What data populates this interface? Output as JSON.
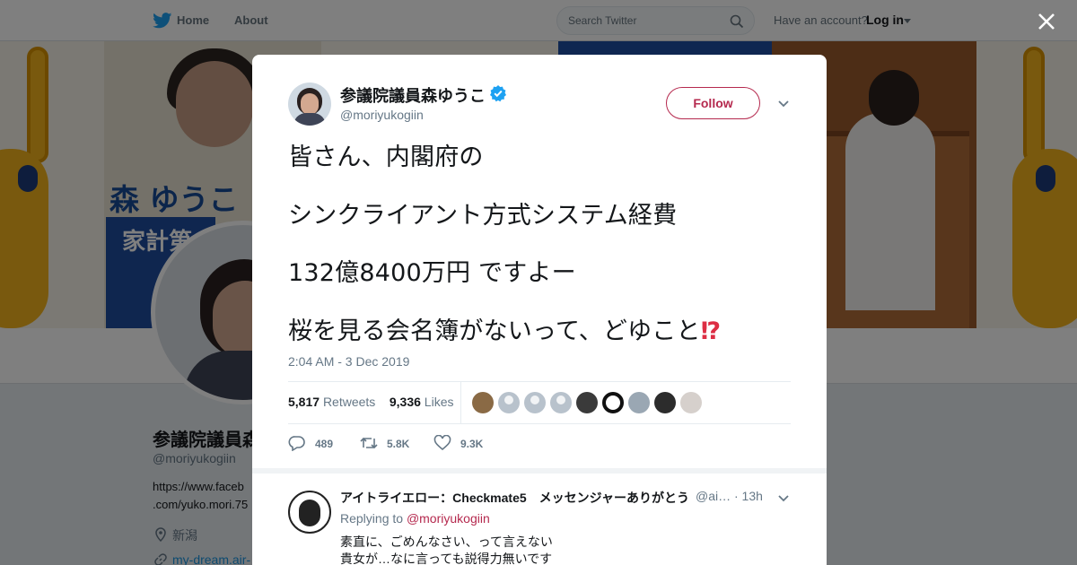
{
  "nav": {
    "home_label": "Home",
    "about_label": "About",
    "search_placeholder": "Search Twitter",
    "account_prompt": "Have an account?",
    "login_label": "Log in"
  },
  "banner": {
    "name_text": "森 ゆうこ",
    "slogan_text": "家計第"
  },
  "profile": {
    "name": "参議院議員森ゆうこ",
    "handle": "@moriyukogiin",
    "url_line1": "https://www.faceb",
    "url_line2": ".com/yuko.mori.75",
    "location": "新潟",
    "website": "my-dream.air-"
  },
  "tweet": {
    "author_name": "参議院議員森ゆうこ",
    "author_handle": "@moriyukogiin",
    "follow_label": "Follow",
    "lines": [
      "皆さん、内閣府の",
      "シンクライアント方式システム経費",
      "132億8400万円  ですよー",
      "桜を見る会名簿がないって、どゆこと"
    ],
    "emoji": "⁉",
    "timestamp": "2:04 AM - 3 Dec 2019",
    "retweets_count": "5,817",
    "retweets_label": "Retweets",
    "likes_count": "9,336",
    "likes_label": "Likes",
    "reply_count": "489",
    "retweet_action_count": "5.8K",
    "like_action_count": "9.3K"
  },
  "reply": {
    "author_name": "アイトライエロー：Checkmate5　メッセンジャーありがとう",
    "author_handle_time": "@ai… · 13h",
    "replying_prefix": "Replying to",
    "replying_handle": "@moriyukogiin",
    "text_line1": "素直に、ごめんなさい、って言えない",
    "text_line2": "貴女が…なに言っても説得力無いです"
  },
  "colors": {
    "brand_blue": "#1da1f2",
    "follow_accent": "#b5294e",
    "verified_blue": "#1da1f2"
  },
  "icons": [
    "twitter-bird-icon",
    "search-icon",
    "caret-down-icon",
    "close-icon",
    "verified-badge-icon",
    "chevron-down-icon",
    "reply-icon",
    "retweet-icon",
    "like-icon",
    "location-icon",
    "link-icon"
  ]
}
